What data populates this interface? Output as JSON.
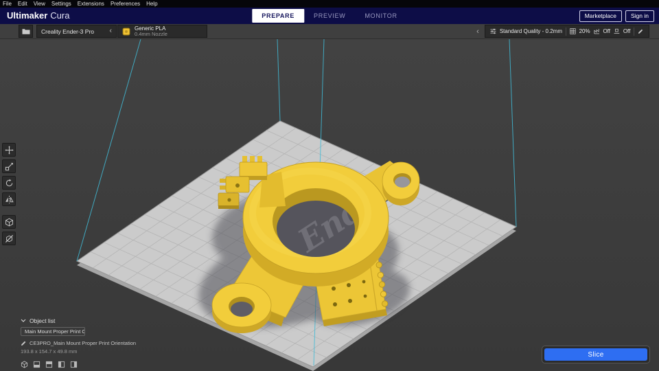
{
  "menubar": {
    "items": [
      "File",
      "Edit",
      "View",
      "Settings",
      "Extensions",
      "Preferences",
      "Help"
    ]
  },
  "header": {
    "logo_primary": "Ultimaker",
    "logo_secondary": "Cura",
    "tabs": [
      {
        "label": "PREPARE",
        "active": true
      },
      {
        "label": "PREVIEW",
        "active": false
      },
      {
        "label": "MONITOR",
        "active": false
      }
    ],
    "marketplace_label": "Marketplace",
    "sign_in_label": "Sign in"
  },
  "stage_toolbar": {
    "printer_name": "Creality Ender-3 Pro",
    "material_name": "Generic PLA",
    "nozzle_size": "0.4mm Nozzle",
    "print_profile": "Standard Quality - 0.2mm",
    "infill_density": "20%",
    "support_state": "Off",
    "adhesion_state": "Off"
  },
  "left_toolbar": {
    "tools": [
      "move",
      "scale",
      "rotate",
      "mirror",
      "per-model-settings",
      "support-blocker"
    ]
  },
  "viewport": {
    "watermark": "Ender",
    "view_presets": [
      "3d-view",
      "front-view",
      "top-view",
      "left-view",
      "right-view"
    ]
  },
  "object_list": {
    "title": "Object list",
    "selected_item": "Main Mount Proper Print Or...",
    "model_name": "CE3PRO_Main Mount Proper Print Orientation",
    "model_dimensions": "193.8 x 154.7 x 49.8 mm"
  },
  "slice_panel": {
    "slice_label": "Slice"
  },
  "icons": {
    "chevron_left": "‹"
  },
  "colors": {
    "header_navy": "#0d0d47",
    "accent_blue": "#2e6ef2",
    "model_yellow": "#f2cd3b",
    "build_volume_cyan": "#41bcd8",
    "build_plate": "#cbcbcb"
  }
}
